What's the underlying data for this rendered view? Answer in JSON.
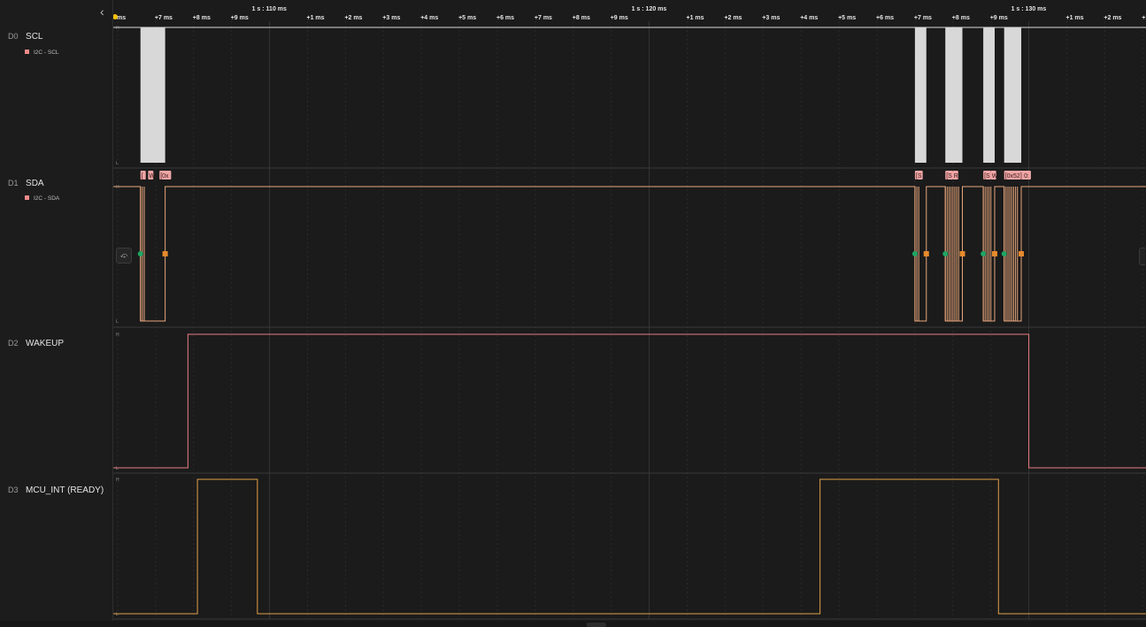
{
  "colors": {
    "background": "#1b1b1b",
    "separator": "#3a3a3a",
    "grid": "#2a2a2a",
    "scl_pulse": "#d8d8d8",
    "sda_trace": "#e8a77c",
    "wakeup_trace": "#e87d86",
    "mcu_trace": "#e2a04a",
    "start_marker": "#1fa665",
    "stop_marker": "#e88a2c",
    "decode_box": "#f0a5a5"
  },
  "timeline": {
    "ticks": [
      {
        "label": "ms",
        "major": false
      },
      {
        "label": "+7 ms",
        "major": false
      },
      {
        "label": "+8 ms",
        "major": false
      },
      {
        "label": "+9 ms",
        "major": false
      },
      {
        "label": "1 s : 110 ms",
        "major": true
      },
      {
        "label": "+1 ms",
        "major": false
      },
      {
        "label": "+2 ms",
        "major": false
      },
      {
        "label": "+3 ms",
        "major": false
      },
      {
        "label": "+4 ms",
        "major": false
      },
      {
        "label": "+5 ms",
        "major": false
      },
      {
        "label": "+6 ms",
        "major": false
      },
      {
        "label": "+7 ms",
        "major": false
      },
      {
        "label": "+8 ms",
        "major": false
      },
      {
        "label": "+9 ms",
        "major": false
      },
      {
        "label": "1 s : 120 ms",
        "major": true
      },
      {
        "label": "+1 ms",
        "major": false
      },
      {
        "label": "+2 ms",
        "major": false
      },
      {
        "label": "+3 ms",
        "major": false
      },
      {
        "label": "+4 ms",
        "major": false
      },
      {
        "label": "+5 ms",
        "major": false
      },
      {
        "label": "+6 ms",
        "major": false
      },
      {
        "label": "+7 ms",
        "major": false
      },
      {
        "label": "+8 ms",
        "major": false
      },
      {
        "label": "+9 ms",
        "major": false
      },
      {
        "label": "1 s : 130 ms",
        "major": true
      },
      {
        "label": "+1 ms",
        "major": false
      },
      {
        "label": "+2 ms",
        "major": false
      },
      {
        "label": "+3 m",
        "major": false
      }
    ]
  },
  "channels": [
    {
      "id": "D0",
      "name": "SCL",
      "analyzer": "I2C - SCL",
      "analyzer_color": "#f08a8a",
      "color": "#d8d8d8"
    },
    {
      "id": "D1",
      "name": "SDA",
      "analyzer": "I2C - SDA",
      "analyzer_color": "#f08a8a",
      "color": "#e8a77c"
    },
    {
      "id": "D2",
      "name": "WAKEUP",
      "analyzer": "",
      "color": "#e87d86"
    },
    {
      "id": "D3",
      "name": "MCU_INT (READY)",
      "analyzer": "",
      "color": "#e2a04a"
    }
  ],
  "level_labels": {
    "high": "H",
    "low": "L"
  },
  "decodes": [
    {
      "text": "[",
      "time_ms": 106.6
    },
    {
      "text": "W",
      "time_ms": 106.8
    },
    {
      "text": "[0x",
      "time_ms": 107.1
    },
    {
      "text": "[S",
      "time_ms": 127.0
    },
    {
      "text": "[S",
      "time_ms": 127.8
    },
    {
      "text": "R",
      "time_ms": 128.0
    },
    {
      "text": "[S",
      "time_ms": 128.8
    },
    {
      "text": "W",
      "time_ms": 129.0
    },
    {
      "text": "[0x52]",
      "time_ms": 129.35
    },
    {
      "text": "0:",
      "time_ms": 129.85
    }
  ],
  "icons": {
    "collapse": "chevron-left-icon",
    "zoom": "zoom-fit-icon"
  }
}
